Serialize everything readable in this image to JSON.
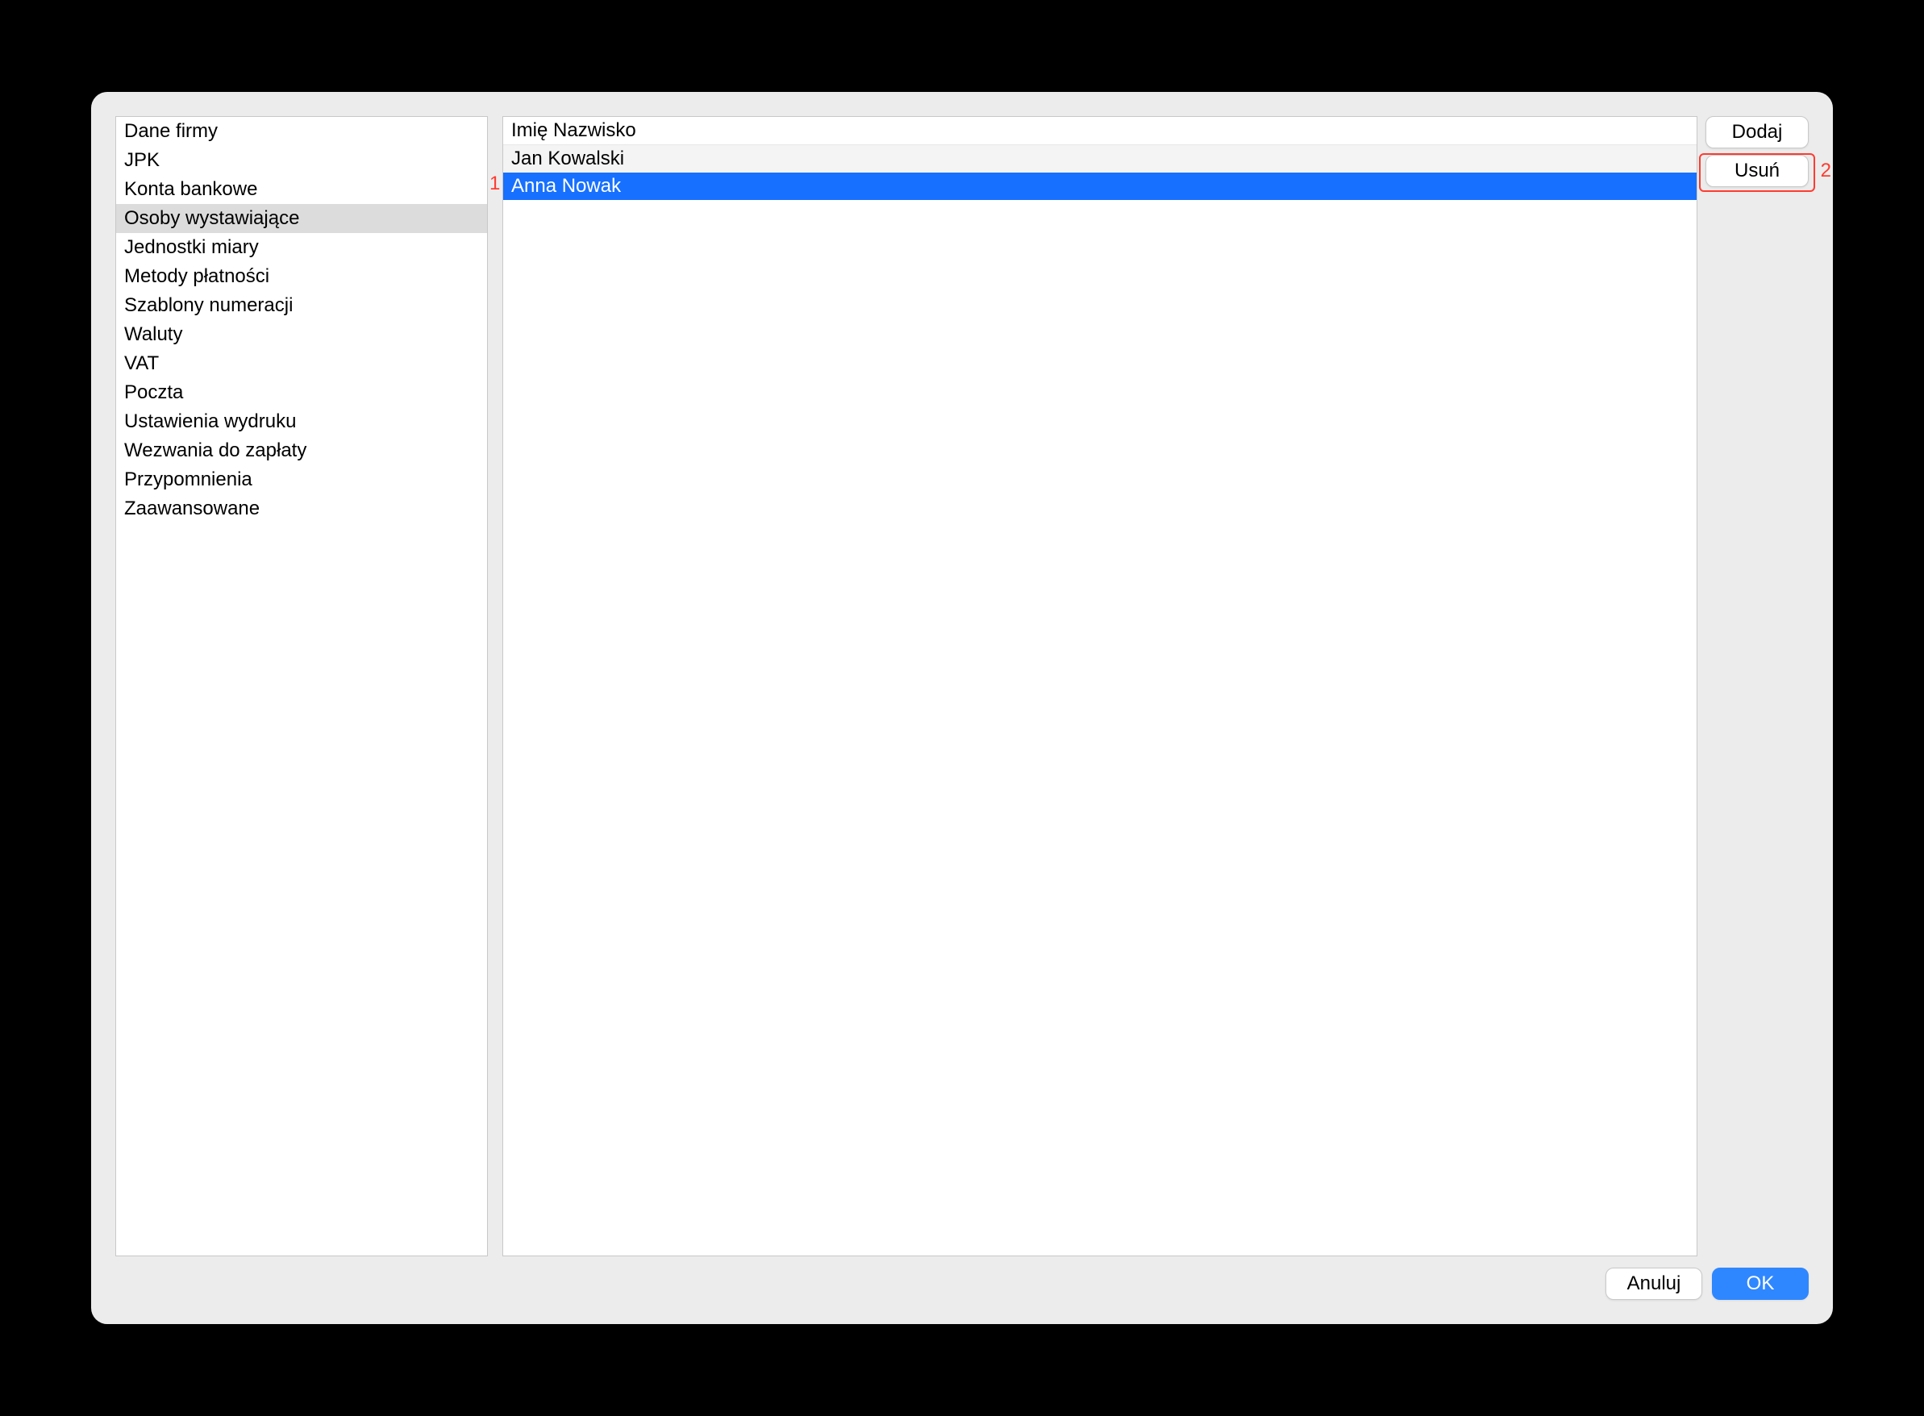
{
  "sidebar": {
    "items": [
      {
        "label": "Dane firmy"
      },
      {
        "label": "JPK"
      },
      {
        "label": "Konta bankowe"
      },
      {
        "label": "Osoby wystawiające",
        "selected": true
      },
      {
        "label": "Jednostki miary"
      },
      {
        "label": "Metody płatności"
      },
      {
        "label": "Szablony numeracji"
      },
      {
        "label": "Waluty"
      },
      {
        "label": "VAT"
      },
      {
        "label": "Poczta"
      },
      {
        "label": "Ustawienia wydruku"
      },
      {
        "label": "Wezwania do zapłaty"
      },
      {
        "label": "Przypomnienia"
      },
      {
        "label": "Zaawansowane"
      }
    ]
  },
  "list": {
    "header": "Imię Nazwisko",
    "rows": [
      {
        "label": "Jan Kowalski"
      },
      {
        "label": "Anna Nowak",
        "selected": true
      }
    ]
  },
  "buttons": {
    "add": "Dodaj",
    "remove": "Usuń",
    "cancel": "Anuluj",
    "ok": "OK"
  },
  "annotations": {
    "left_num": "1",
    "right_num": "2"
  }
}
